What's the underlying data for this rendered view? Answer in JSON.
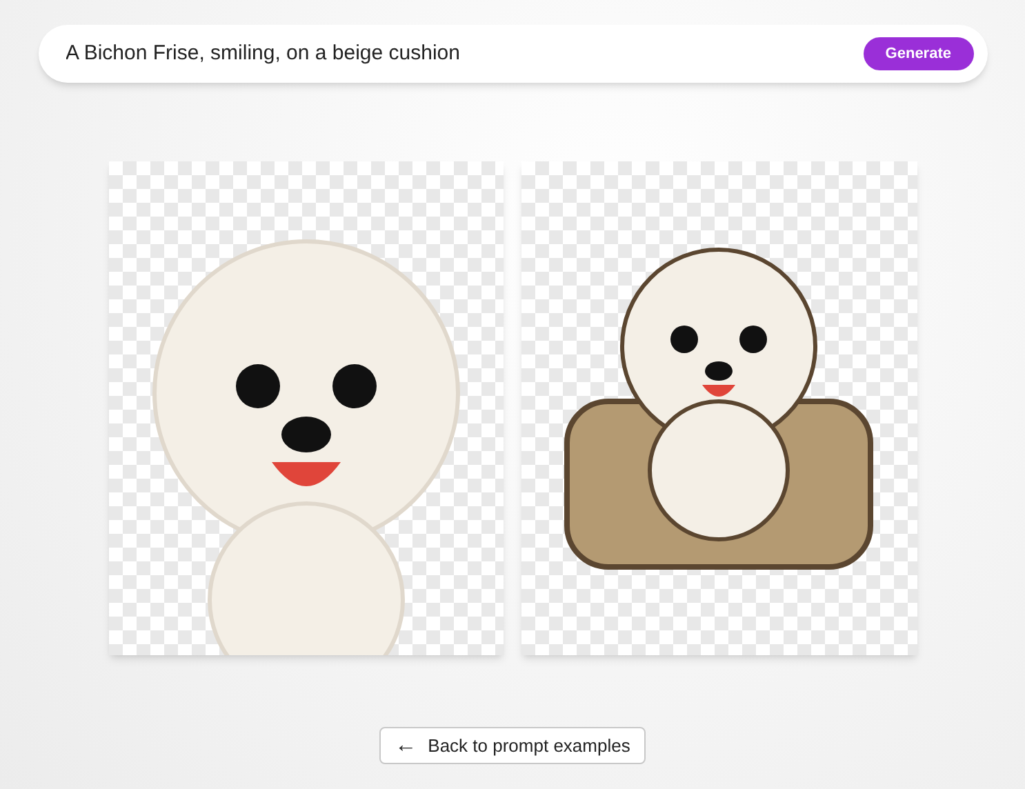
{
  "prompt_bar": {
    "value": "A Bichon Frise, smiling, on a beige cushion",
    "button": "Generate"
  },
  "back_button": {
    "arrow": "←",
    "label": "Back to prompt examples"
  }
}
